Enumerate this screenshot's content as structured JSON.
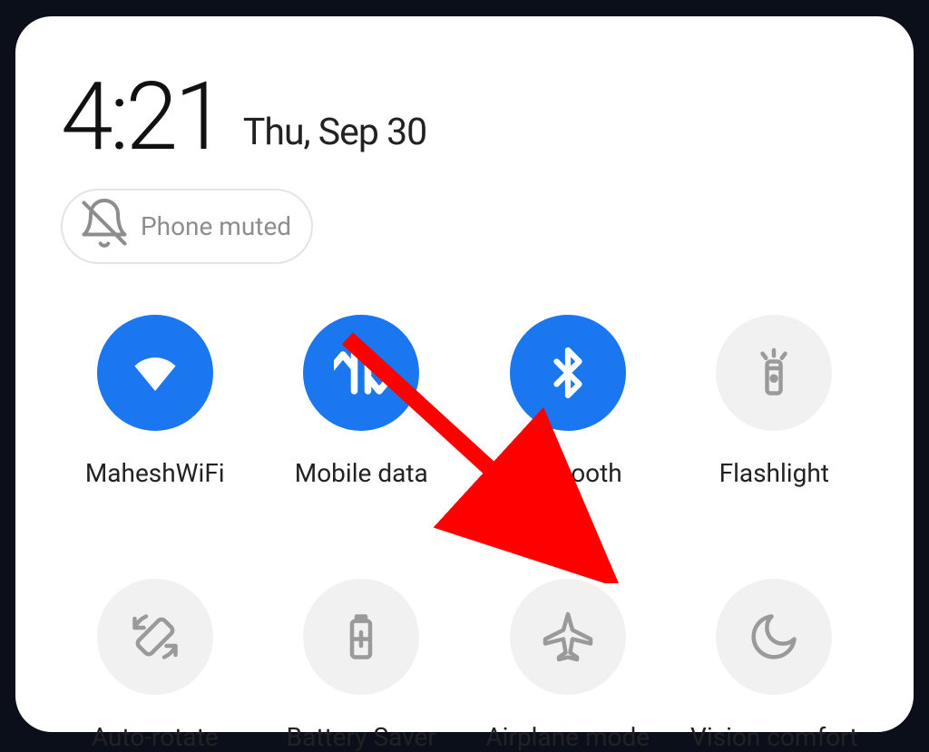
{
  "clock": {
    "time": "4:21",
    "date": "Thu, Sep 30"
  },
  "status": {
    "muted_label": "Phone muted"
  },
  "tiles": {
    "wifi": {
      "label": "MaheshWiFi",
      "active": true
    },
    "mobile_data": {
      "label": "Mobile data",
      "active": true
    },
    "bluetooth": {
      "label": "Bluetooth",
      "active": true
    },
    "flashlight": {
      "label": "Flashlight",
      "active": false
    },
    "autorotate": {
      "label": "Auto-rotate",
      "active": false
    },
    "battery": {
      "label": "Battery Saver",
      "active": false
    },
    "airplane": {
      "label": "Airplane mode",
      "active": false
    },
    "vision": {
      "label": "Vision comfort",
      "active": false
    }
  },
  "annotation": {
    "arrow_points_to": "airplane"
  },
  "colors": {
    "accent": "#1a77ef",
    "off_bg": "#f1f1f1",
    "arrow": "#ff0000"
  }
}
